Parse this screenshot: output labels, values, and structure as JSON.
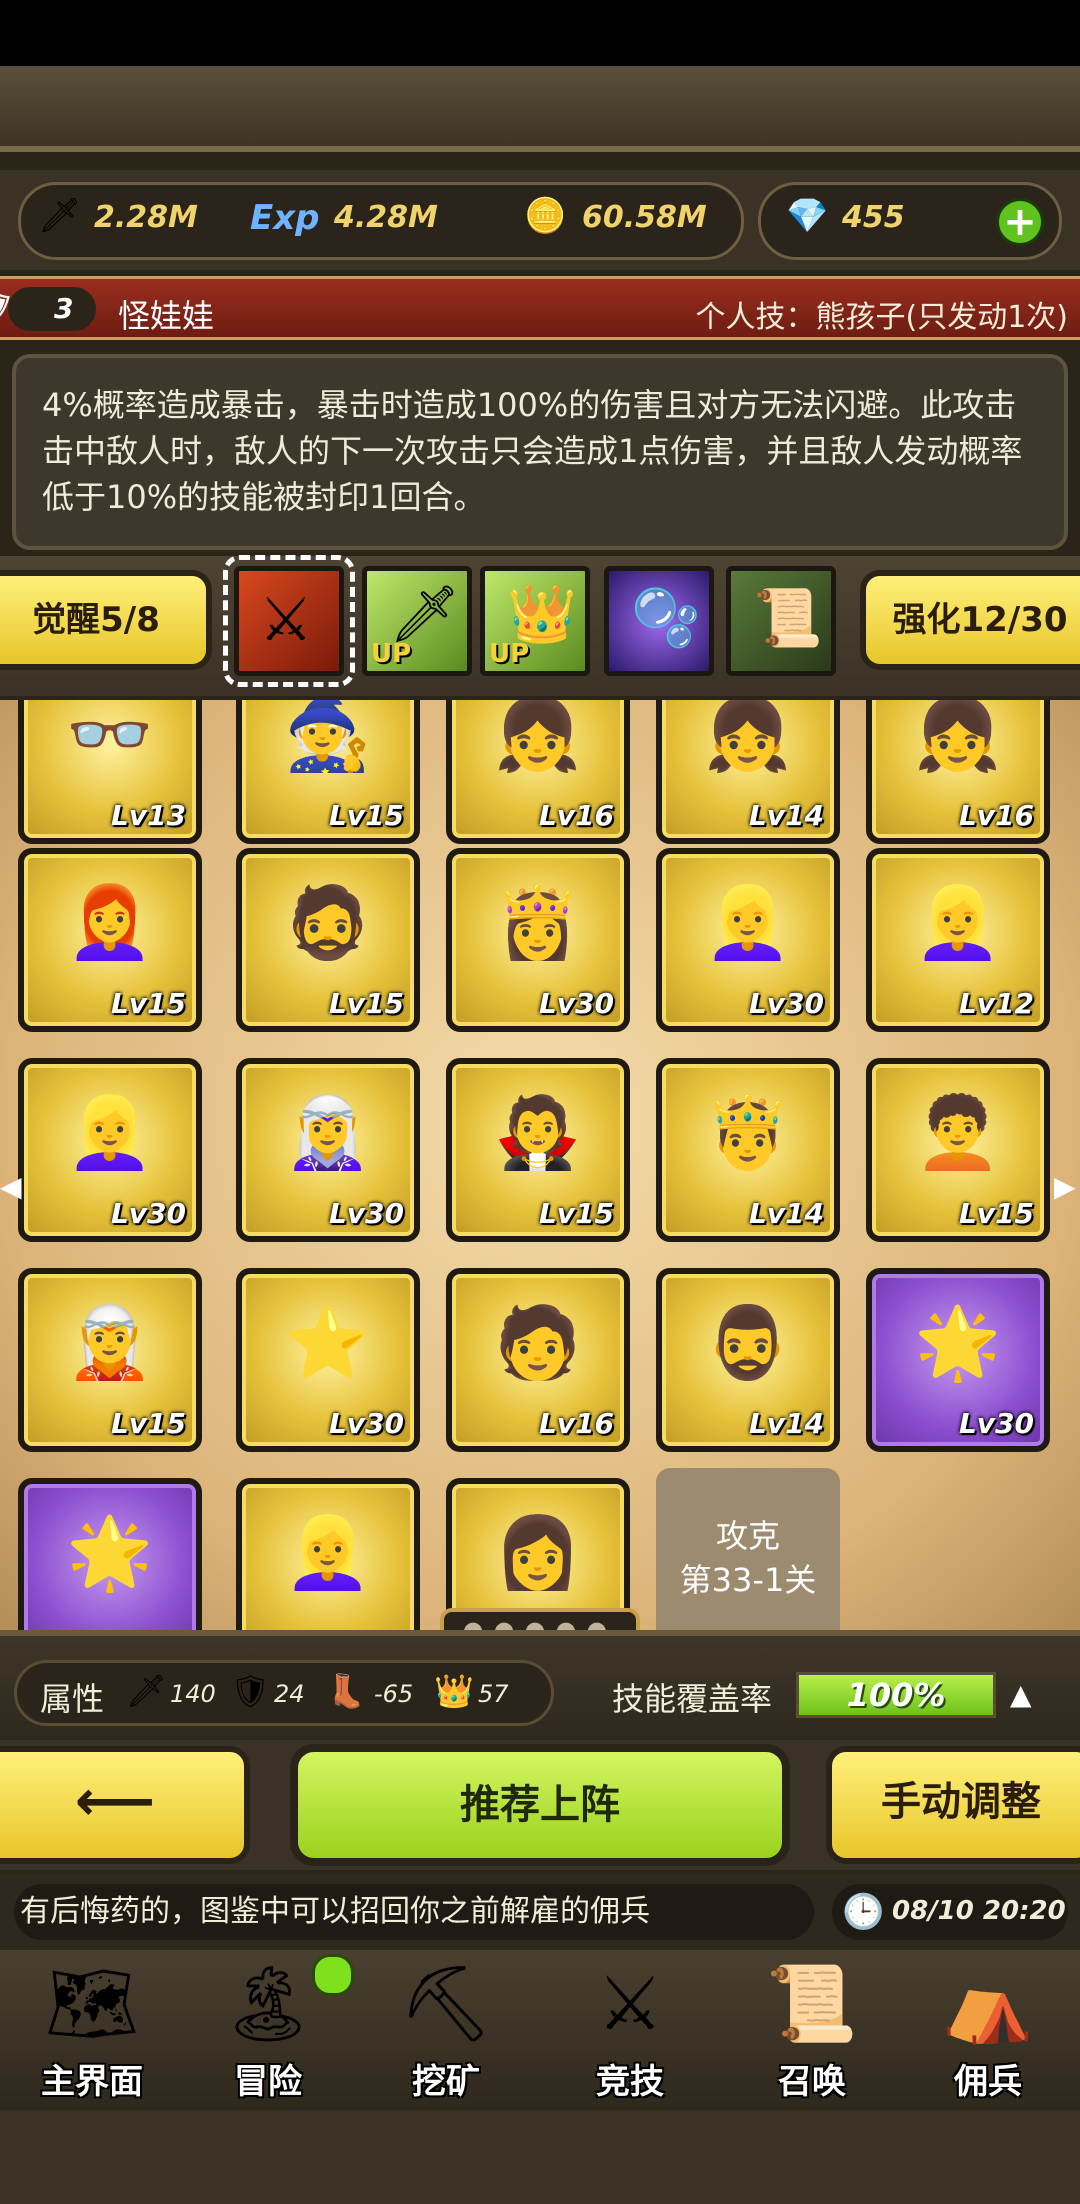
{
  "resources": {
    "attack": "2.28M",
    "exp_label": "Exp",
    "exp": "4.28M",
    "gold": "60.58M",
    "gems": "455",
    "add_label": "+"
  },
  "hero": {
    "level": "3",
    "name": "怪娃娃",
    "skill_title": "个人技：熊孩子(只发动1次)",
    "description": "4%概率造成暴击，暴击时造成100%的伤害且对方无法闪避。此攻击击中敌人时，敌人的下一次攻击只会造成1点伤害，并且敌人发动概率低于10%的技能被封印1回合。"
  },
  "awaken_label": "觉醒5/8",
  "enhance_label": "强化12/30",
  "skills": [
    {
      "icon": "sword-slash-icon",
      "badge": ""
    },
    {
      "icon": "sword-up-icon",
      "badge": "UP"
    },
    {
      "icon": "crown-up-icon",
      "badge": "UP"
    },
    {
      "icon": "slime-icon",
      "badge": ""
    },
    {
      "icon": "scroll-icon",
      "badge": ""
    }
  ],
  "heroes": [
    {
      "lv": "Lv13",
      "purple": false,
      "glyph": "👓"
    },
    {
      "lv": "Lv15",
      "purple": false,
      "glyph": "🧙"
    },
    {
      "lv": "Lv16",
      "purple": false,
      "glyph": "👧"
    },
    {
      "lv": "Lv14",
      "purple": false,
      "glyph": "👧"
    },
    {
      "lv": "Lv16",
      "purple": false,
      "glyph": "👧"
    },
    {
      "lv": "Lv15",
      "purple": false,
      "glyph": "👩‍🦰"
    },
    {
      "lv": "Lv15",
      "purple": false,
      "glyph": "🧔"
    },
    {
      "lv": "Lv30",
      "purple": false,
      "glyph": "👸"
    },
    {
      "lv": "Lv30",
      "purple": false,
      "glyph": "👱‍♀️"
    },
    {
      "lv": "Lv12",
      "purple": false,
      "glyph": "👱‍♀️"
    },
    {
      "lv": "Lv30",
      "purple": false,
      "glyph": "👱‍♀️"
    },
    {
      "lv": "Lv30",
      "purple": false,
      "glyph": "🧝‍♀️"
    },
    {
      "lv": "Lv15",
      "purple": false,
      "glyph": "🧛"
    },
    {
      "lv": "Lv14",
      "purple": false,
      "glyph": "🤴"
    },
    {
      "lv": "Lv15",
      "purple": false,
      "glyph": "🧑‍🦱"
    },
    {
      "lv": "Lv15",
      "purple": false,
      "glyph": "🧝"
    },
    {
      "lv": "Lv30",
      "purple": false,
      "glyph": "⭐"
    },
    {
      "lv": "Lv16",
      "purple": false,
      "glyph": "🧑"
    },
    {
      "lv": "Lv14",
      "purple": false,
      "glyph": "🧔‍♂️"
    },
    {
      "lv": "Lv30",
      "purple": true,
      "glyph": "🌟"
    },
    {
      "lv": "",
      "purple": true,
      "glyph": "🌟"
    },
    {
      "lv": "",
      "purple": false,
      "glyph": "👱‍♀️"
    },
    {
      "lv": "",
      "purple": false,
      "glyph": "👩"
    }
  ],
  "locked_stage": {
    "line1": "攻克",
    "line2": "第33-1关"
  },
  "stats": {
    "attr_label": "属性",
    "atk": "140",
    "def": "24",
    "speed": "-65",
    "crown": "57",
    "coverage_label": "技能覆盖率",
    "coverage": "100%",
    "coverage_value": 1.0
  },
  "actions": {
    "back_label": "⟵",
    "recommend": "推荐上阵",
    "manual": "手动调整"
  },
  "ticker": {
    "text": "有后悔药的，图鉴中可以招回你之前解雇的佣兵",
    "time": "08/10 20:20"
  },
  "nav": [
    {
      "label": "主界面",
      "icon": "map-scroll-icon"
    },
    {
      "label": "冒险",
      "icon": "island-icon"
    },
    {
      "label": "挖矿",
      "icon": "pickaxe-icon"
    },
    {
      "label": "竞技",
      "icon": "crossed-swords-icon"
    },
    {
      "label": "召唤",
      "icon": "summon-scroll-icon"
    },
    {
      "label": "佣兵",
      "icon": "tent-icon"
    }
  ]
}
